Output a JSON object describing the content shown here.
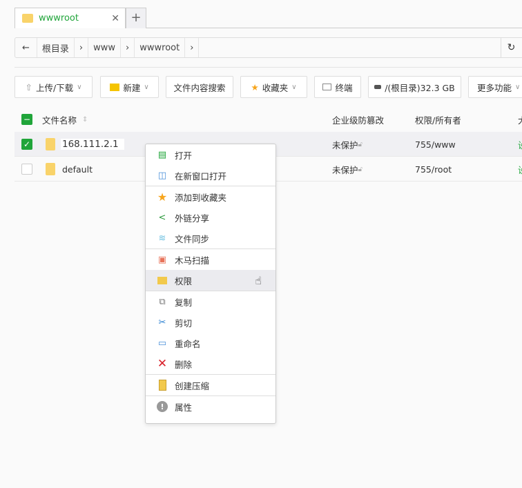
{
  "tabs": [
    {
      "label": "wwwroot"
    }
  ],
  "breadcrumb": [
    "根目录",
    "www",
    "wwwroot"
  ],
  "toolbar": {
    "upload": "上传/下载",
    "new": "新建",
    "search": "文件内容搜索",
    "favorites": "收藏夹",
    "terminal": "终端",
    "disk": "/(根目录)32.3 GB",
    "more": "更多功能"
  },
  "table": {
    "headers": {
      "name": "文件名称",
      "tamper": "企业级防篡改",
      "perm": "权限/所有者",
      "last": "大"
    },
    "rows": [
      {
        "name": "168.111.2.1",
        "tamper": "未保护",
        "perm": "755/www",
        "last": "设",
        "checked": true
      },
      {
        "name": "default",
        "tamper": "未保护",
        "perm": "755/root",
        "last": "设",
        "checked": false
      }
    ]
  },
  "menu": {
    "groups": [
      [
        "打开",
        "在新窗口打开"
      ],
      [
        "添加到收藏夹",
        "外链分享",
        "文件同步"
      ],
      [
        "木马扫描",
        "权限"
      ],
      [
        "复制",
        "剪切",
        "重命名",
        "删除"
      ],
      [
        "创建压缩"
      ],
      [
        "属性"
      ]
    ]
  },
  "colors": {
    "accent": "#20a53a",
    "folder": "#f9d36a"
  }
}
